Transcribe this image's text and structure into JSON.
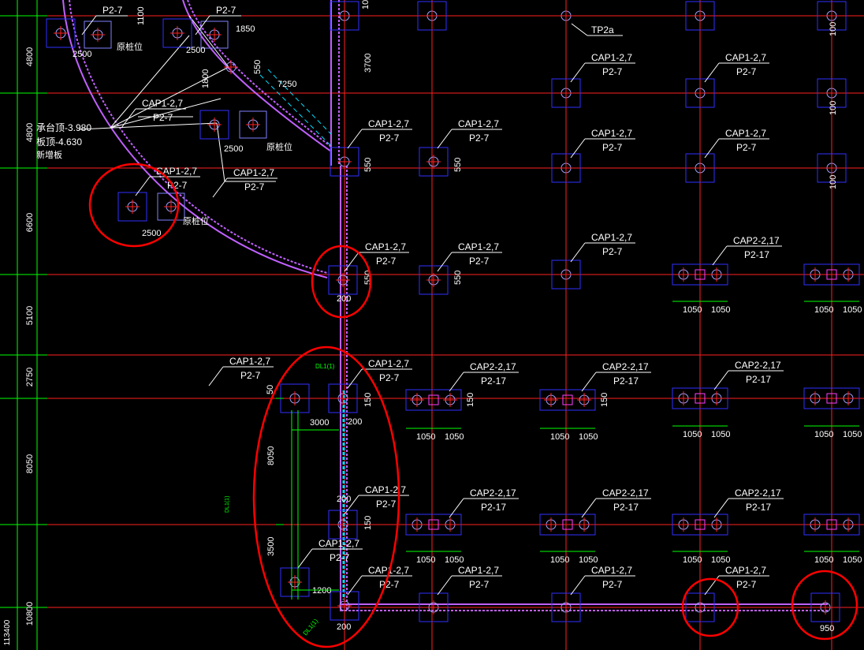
{
  "colors": {
    "background": "#000000",
    "grid_red": "#ff2020",
    "grid_green": "#00ff00",
    "cap_box": "#3030ff",
    "text_white": "#ffffff",
    "wall_magenta": "#c060ff",
    "annotation_red": "#ff0000",
    "cyan": "#00e0ff"
  },
  "left_dims": [
    "4800",
    "4800",
    "6600",
    "5100",
    "2750",
    "8050",
    "10800",
    "113400"
  ],
  "left_note": {
    "line1": "承台顶-3.980",
    "line2": "板顶-4.630",
    "line3": "新增板"
  },
  "cap_labels": {
    "cap1": "CAP1-2,7",
    "p27": "P2-7",
    "cap2": "CAP2-2,17",
    "p217": "P2-17",
    "tp": "TP2a"
  },
  "dims": {
    "d2500": "2500",
    "d1850": "1850",
    "d1050": "1050",
    "d950": "950",
    "d550": "550",
    "d150": "150",
    "d100": "100",
    "d200": "200",
    "d3000": "3000",
    "d8050": "8050",
    "d3500": "3500",
    "d1200": "1200",
    "d7250": "7250",
    "d3700": "3700",
    "d1100": "1100",
    "d1800": "1800",
    "d50": "50"
  },
  "notes": {
    "original_pos": "原桩位",
    "small_green": "DL1(1)"
  }
}
